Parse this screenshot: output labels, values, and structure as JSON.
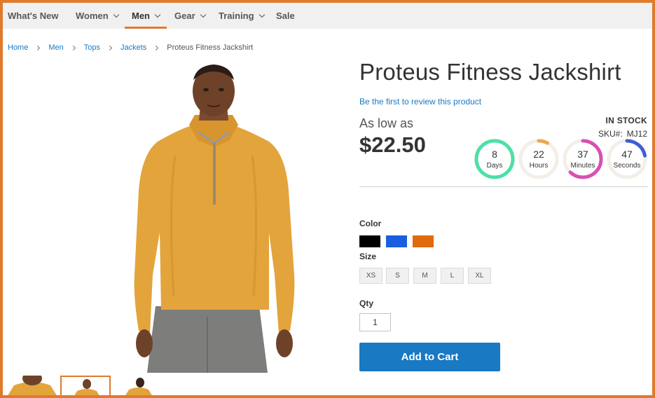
{
  "nav": {
    "items": [
      {
        "label": "What's New",
        "has_dropdown": false
      },
      {
        "label": "Women",
        "has_dropdown": true
      },
      {
        "label": "Men",
        "has_dropdown": true,
        "active": true
      },
      {
        "label": "Gear",
        "has_dropdown": true
      },
      {
        "label": "Training",
        "has_dropdown": true
      },
      {
        "label": "Sale",
        "has_dropdown": false
      }
    ]
  },
  "breadcrumb": {
    "links": [
      "Home",
      "Men",
      "Tops",
      "Jackets"
    ],
    "current": "Proteus Fitness Jackshirt"
  },
  "product": {
    "title": "Proteus Fitness Jackshirt",
    "review_link": "Be the first to review this product",
    "price_label": "As low as",
    "price": "$22.50",
    "stock": "IN STOCK",
    "sku_label": "SKU#:",
    "sku": "MJ12"
  },
  "countdown": [
    {
      "value": "8",
      "unit": "Days",
      "color": "#4de0a6",
      "fraction": 1.0
    },
    {
      "value": "22",
      "unit": "Hours",
      "color": "#e8a94e",
      "fraction": 0.08
    },
    {
      "value": "37",
      "unit": "Minutes",
      "color": "#d94fb4",
      "fraction": 0.62
    },
    {
      "value": "47",
      "unit": "Seconds",
      "color": "#3f5fd6",
      "fraction": 0.22
    }
  ],
  "options": {
    "color_label": "Color",
    "colors": [
      "#000000",
      "#1a5ee0",
      "#e06a0e"
    ],
    "size_label": "Size",
    "sizes": [
      "XS",
      "S",
      "M",
      "L",
      "XL"
    ],
    "qty_label": "Qty",
    "qty_value": "1"
  },
  "cart": {
    "add_label": "Add to Cart"
  },
  "theme": {
    "accent": "#e07a2c",
    "link": "#1979c3",
    "button": "#1979c3"
  }
}
